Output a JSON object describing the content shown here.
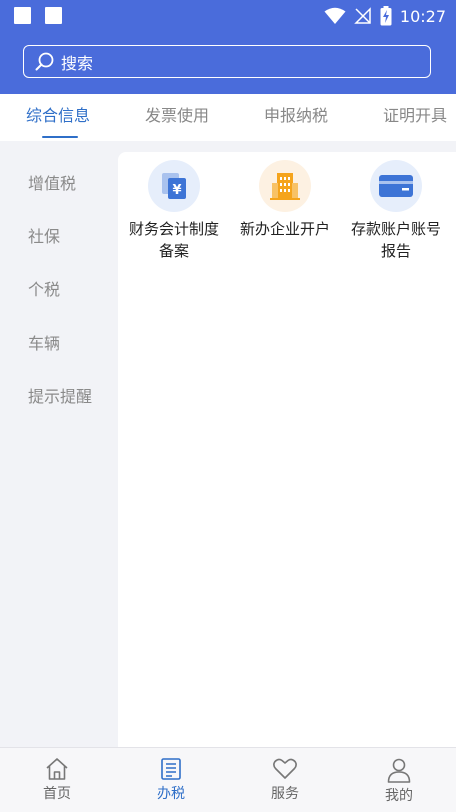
{
  "status_bar": {
    "time": "10:27"
  },
  "search": {
    "placeholder": "搜索"
  },
  "tabs": [
    {
      "label": "综合信息",
      "active": true
    },
    {
      "label": "发票使用",
      "active": false
    },
    {
      "label": "申报纳税",
      "active": false
    },
    {
      "label": "证明开具",
      "active": false
    }
  ],
  "sidebar": {
    "items": [
      {
        "label": "增值税"
      },
      {
        "label": "社保"
      },
      {
        "label": "个税"
      },
      {
        "label": "车辆"
      },
      {
        "label": "提示提醒"
      }
    ]
  },
  "services": [
    {
      "label": "财务会计制度备案",
      "icon": "document-yen-icon",
      "icon_bg": "#e6eefb",
      "icon_color": "#3d74d6"
    },
    {
      "label": "新办企业开户",
      "icon": "building-icon",
      "icon_bg": "#fdf1e2",
      "icon_color": "#f5a41c"
    },
    {
      "label": "存款账户账号报告",
      "icon": "card-icon",
      "icon_bg": "#e6eefb",
      "icon_color": "#3d74d6"
    }
  ],
  "bottom_nav": [
    {
      "label": "首页",
      "icon": "home-icon",
      "active": false
    },
    {
      "label": "办税",
      "icon": "list-icon",
      "active": true
    },
    {
      "label": "服务",
      "icon": "heart-icon",
      "active": false
    },
    {
      "label": "我的",
      "icon": "person-icon",
      "active": false
    }
  ],
  "colors": {
    "brand": "#4a6cdb",
    "accent": "#2f6fc8"
  }
}
